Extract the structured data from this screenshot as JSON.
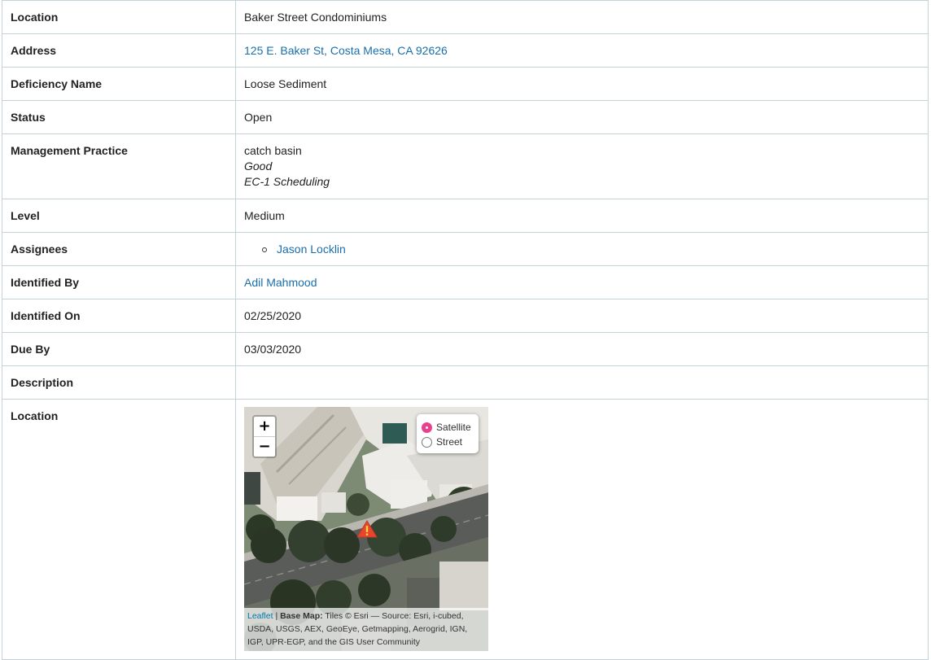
{
  "rows": {
    "location": {
      "label": "Location",
      "value": "Baker Street Condominiums"
    },
    "address": {
      "label": "Address",
      "value": "125 E. Baker St, Costa Mesa, CA 92626"
    },
    "deficiency": {
      "label": "Deficiency Name",
      "value": "Loose Sediment"
    },
    "status": {
      "label": "Status",
      "value": "Open"
    },
    "management": {
      "label": "Management Practice",
      "lines": [
        "catch basin",
        "Good",
        "EC-1 Scheduling"
      ]
    },
    "level": {
      "label": "Level",
      "value": "Medium"
    },
    "assignees": {
      "label": "Assignees",
      "items": [
        "Jason Locklin"
      ]
    },
    "identified_by": {
      "label": "Identified By",
      "value": "Adil Mahmood"
    },
    "identified_on": {
      "label": "Identified On",
      "value": "02/25/2020"
    },
    "due_by": {
      "label": "Due By",
      "value": "03/03/2020"
    },
    "description": {
      "label": "Description",
      "value": ""
    },
    "map_location": {
      "label": "Location"
    }
  },
  "map": {
    "zoom_in": "+",
    "zoom_out": "−",
    "layers": [
      {
        "label": "Satellite",
        "selected": true
      },
      {
        "label": "Street",
        "selected": false
      }
    ],
    "marker_icon": "warning-triangle-icon",
    "attribution": {
      "leaflet": "Leaflet",
      "sep": " | ",
      "basemap_label": "Base Map:",
      "text": " Tiles © Esri — Source: Esri, i-cubed, USDA, USGS, AEX, GeoEye, Getmapping, Aerogrid, IGN, IGP, UPR-EGP, and the GIS User Community"
    }
  },
  "colors": {
    "link": "#1a6fab",
    "border": "#c5d3d8",
    "radio_selected": "#e8418e",
    "marker": "#e8452c"
  }
}
